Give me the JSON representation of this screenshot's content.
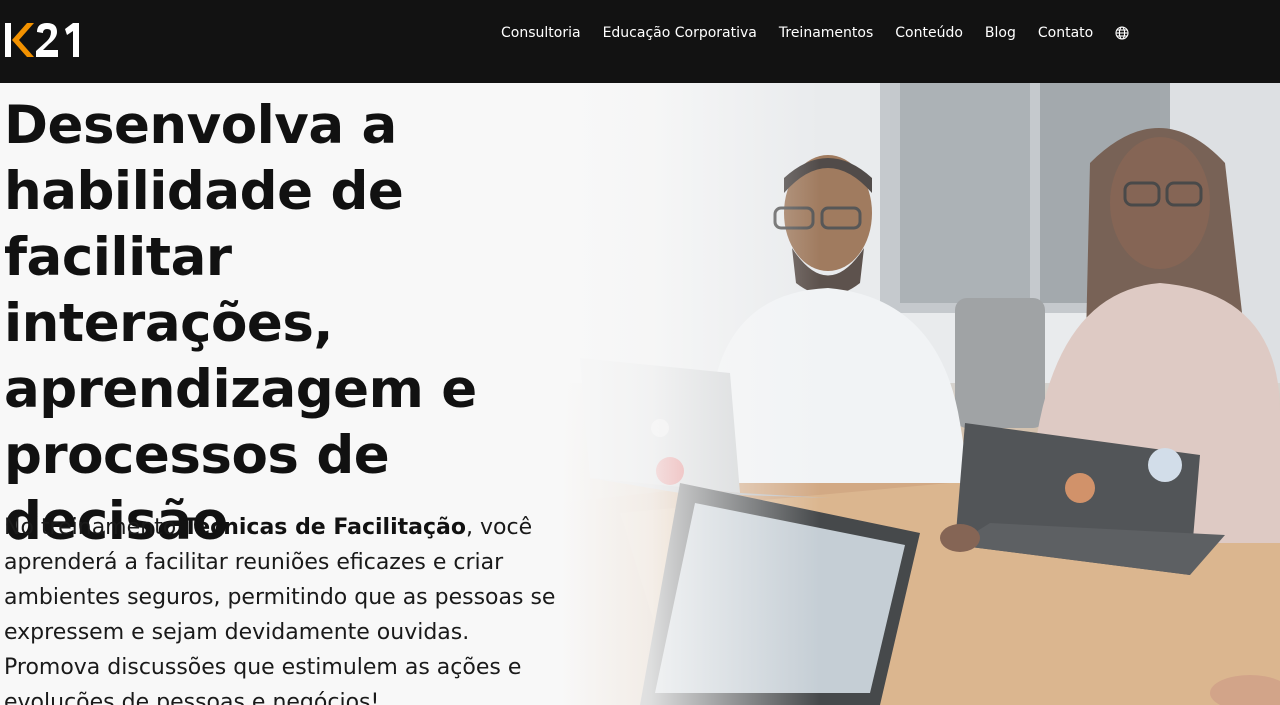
{
  "header": {
    "logo_text": "K21",
    "nav": [
      {
        "label": "Consultoria"
      },
      {
        "label": "Educação Corporativa"
      },
      {
        "label": "Treinamentos"
      },
      {
        "label": "Conteúdo"
      },
      {
        "label": "Blog"
      },
      {
        "label": "Contato"
      }
    ],
    "language_icon": "globe-icon"
  },
  "hero": {
    "headline": "Desenvolva a habilidade de facilitar interações, aprendizagem e processos de decisão",
    "intro_before": "No treinamento ",
    "intro_bold": "Técnicas de Facilitação",
    "intro_after": ", você aprenderá a facilitar reuniões eficazes e criar ambientes seguros, permitindo que as pessoas se expressem e sejam devidamente ouvidas. Promova discussões que estimulem as ações e evoluções de pessoas e negócios!"
  },
  "colors": {
    "topbar": "#121212",
    "logo_accent": "#f39200",
    "text": "#111111"
  }
}
